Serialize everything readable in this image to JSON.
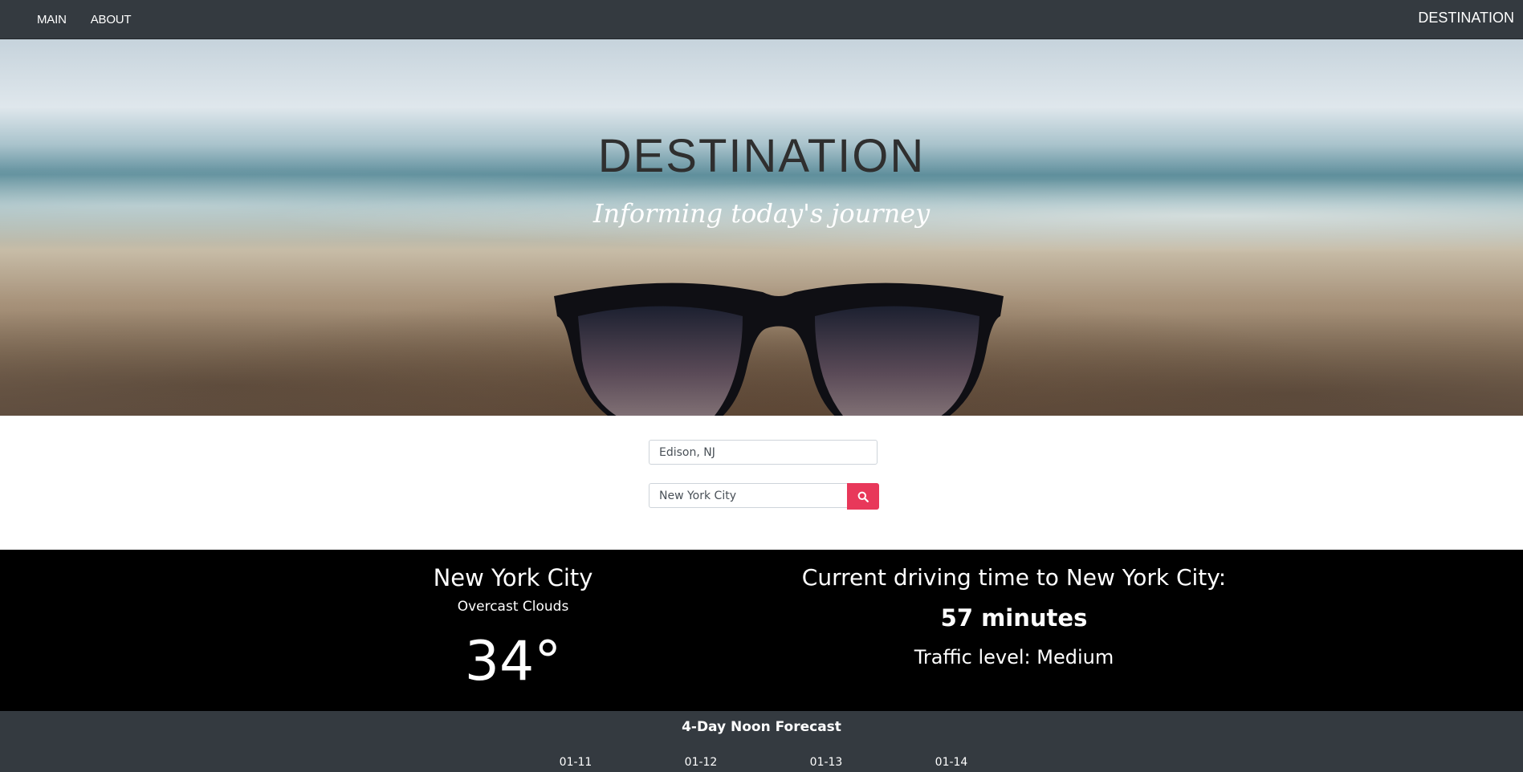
{
  "nav": {
    "items": [
      {
        "label": "MAIN"
      },
      {
        "label": "ABOUT"
      }
    ],
    "brand": "DESTINATION"
  },
  "hero": {
    "title": "DESTINATION",
    "subtitle": "Informing today's journey"
  },
  "search": {
    "origin_value": "Edison, NJ",
    "destination_value": "New York City",
    "button_icon": "search-icon",
    "button_color": "#e8385a"
  },
  "weather": {
    "city": "New York City",
    "conditions": "Overcast Clouds",
    "temperature": "34°"
  },
  "drive": {
    "heading": "Current driving time to New York City:",
    "time": "57 minutes",
    "traffic": "Traffic level: Medium"
  },
  "forecast": {
    "title": "4-Day Noon Forecast",
    "days": [
      "01-11",
      "01-12",
      "01-13",
      "01-14"
    ]
  }
}
